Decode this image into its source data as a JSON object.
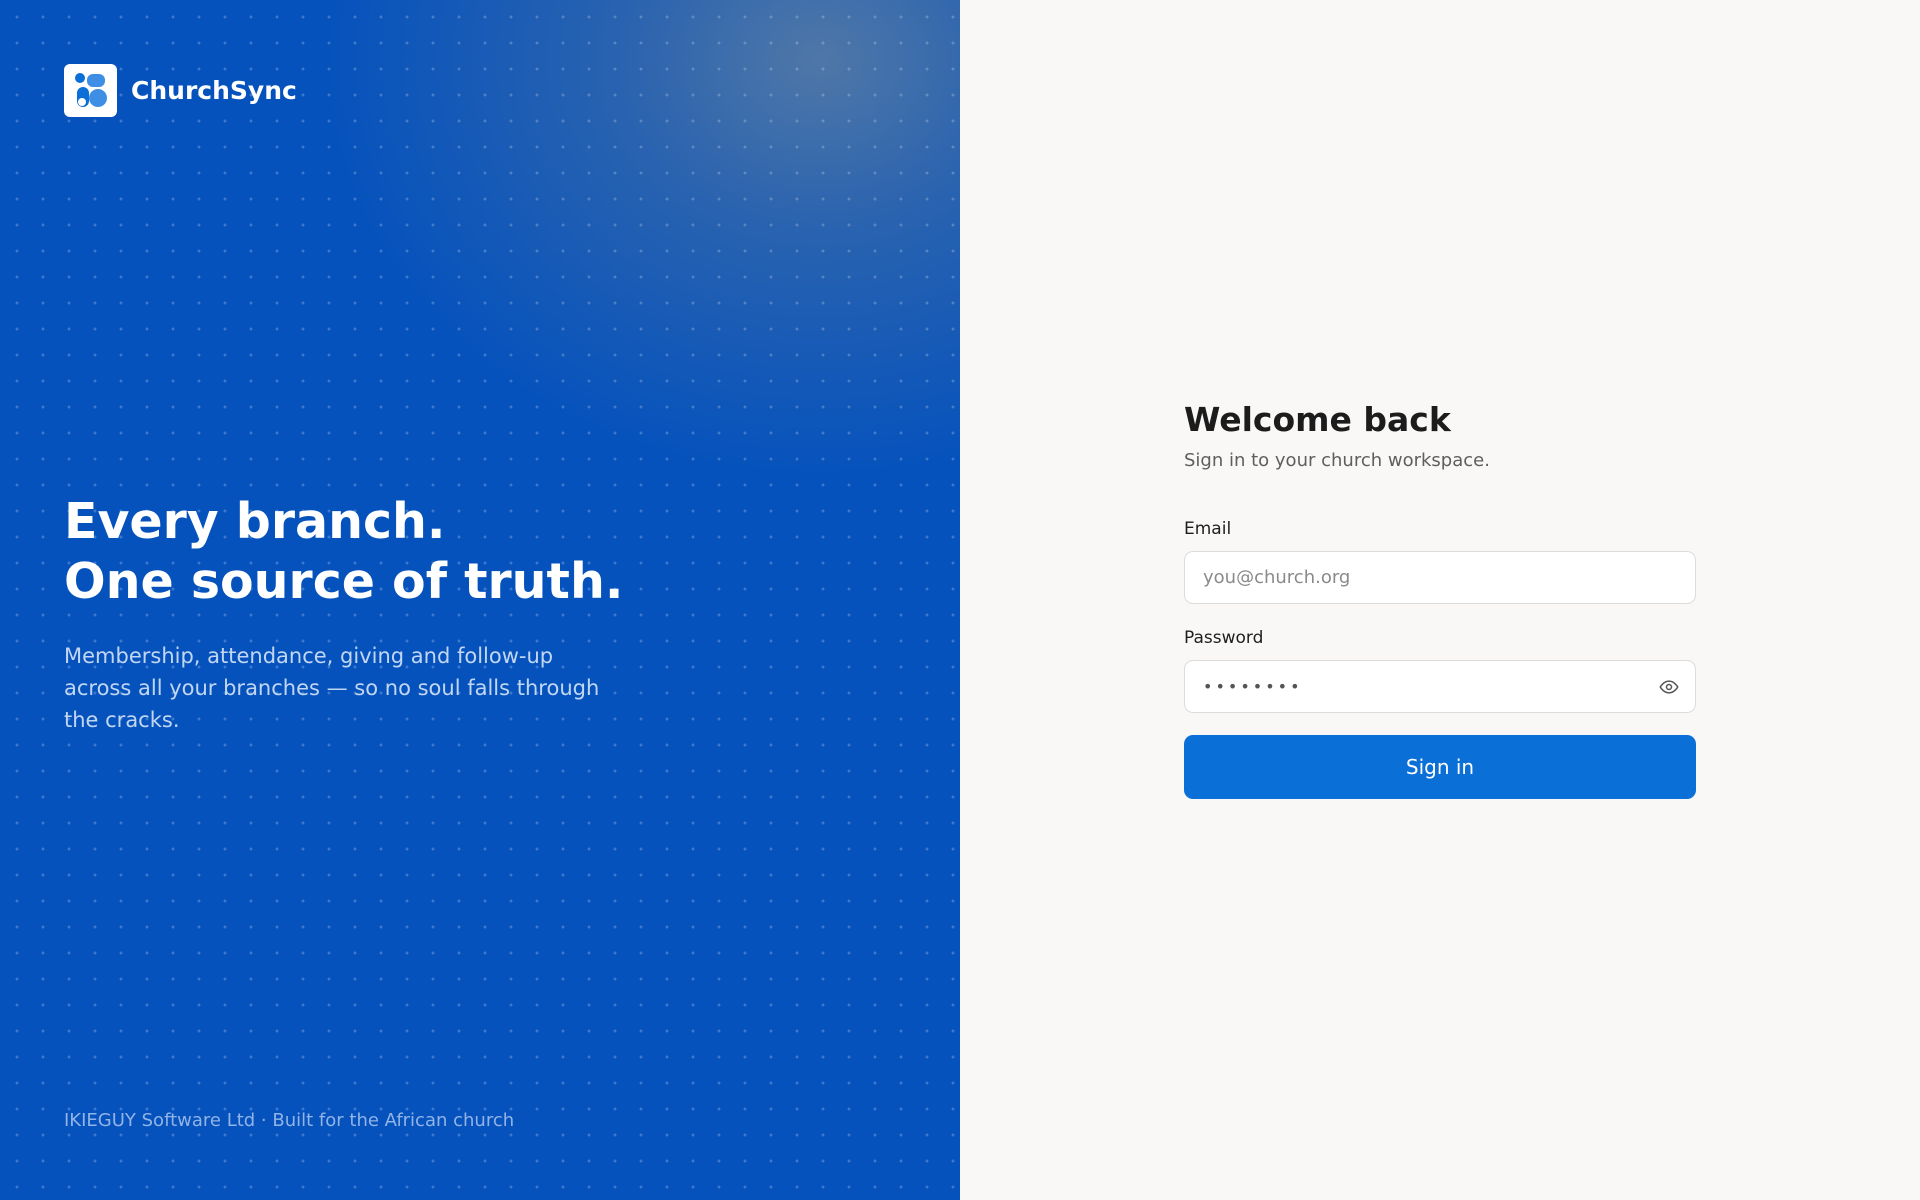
{
  "brand": {
    "name": "ChurchSync",
    "logo_icon": "churchsync-logo-icon",
    "headline_line1": "Every branch.",
    "headline_line2": "One source of truth.",
    "tagline": "Membership, attendance, giving and follow-up across all your branches — so no soul falls through the cracks.",
    "footer": "IKIEGUY Software Ltd · Built for the African church"
  },
  "form": {
    "title": "Welcome back",
    "subtitle": "Sign in to your church workspace.",
    "email_label": "Email",
    "email_placeholder": "you@church.org",
    "email_value": "",
    "password_label": "Password",
    "password_value": "••••••••",
    "password_toggle_icon": "eye-icon",
    "submit_label": "Sign in"
  },
  "colors": {
    "brand_panel": "#0552bd",
    "primary_button": "#0a6fd6",
    "form_background": "#f9f8f6"
  }
}
